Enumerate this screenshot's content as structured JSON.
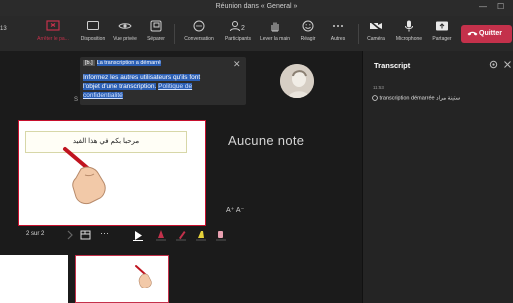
{
  "window": {
    "title": "Réunion dans « General »",
    "minimize": "—",
    "maximize": "☐"
  },
  "toolbar": {
    "left_items": [
      {
        "label": "Arrêter le pa...",
        "icon": "stop-sharing-icon",
        "active": true
      },
      {
        "label": "Disposition",
        "icon": "layout-icon"
      },
      {
        "label": "Vue privée",
        "icon": "eye-icon"
      },
      {
        "label": "Séparer",
        "icon": "pop-out-icon"
      },
      {
        "label": "Conversation",
        "icon": "chat-icon"
      },
      {
        "label": "Participants",
        "icon": "participants-icon",
        "badge": "2"
      },
      {
        "label": "Lever la main",
        "icon": "raise-hand-icon"
      },
      {
        "label": "Réagir",
        "icon": "react-icon"
      },
      {
        "label": "Autres",
        "icon": "more-icon"
      }
    ],
    "right_items": [
      {
        "label": "Caméra",
        "icon": "camera-off-icon"
      },
      {
        "label": "Microphone",
        "icon": "microphone-icon"
      },
      {
        "label": "Partager",
        "icon": "share-icon"
      }
    ],
    "quit_label": "Quitter",
    "counter": "13"
  },
  "notification": {
    "tag": "[b.]",
    "head": "La transcription a démarré",
    "body_line1": "Informez les autres utilisateurs qu'ils font",
    "body_line2": "l'objet d'une transcription.",
    "body_link": "Politique de",
    "body_line3": "confidentialité"
  },
  "stage": {
    "s_label": "S",
    "slide_text": "مرحبا بكم في هذا الفيد",
    "notes_placeholder": "Aucune note",
    "font_size_controls": "A⁺  A⁻",
    "page_indicator": "2 sur 2"
  },
  "transcript": {
    "title": "Transcript",
    "time": "11:53",
    "entry_text": "transcription démarrée",
    "entry_name": "ستينة مراد"
  },
  "colors": {
    "accent_red": "#c4314b",
    "highlight_blue": "#2b5fb5"
  }
}
